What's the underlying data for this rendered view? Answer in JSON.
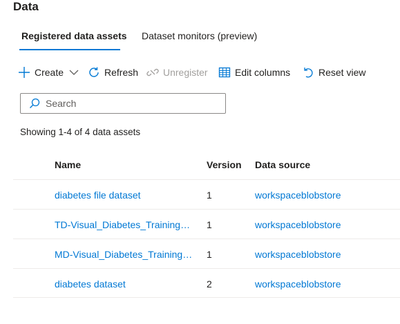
{
  "page": {
    "title": "Data"
  },
  "tabs": [
    {
      "label": "Registered data assets",
      "active": true
    },
    {
      "label": "Dataset monitors (preview)",
      "active": false
    }
  ],
  "toolbar": {
    "create": {
      "label": "Create",
      "icon": "plus-icon"
    },
    "refresh": {
      "label": "Refresh",
      "icon": "refresh-icon"
    },
    "unregister": {
      "label": "Unregister",
      "icon": "unlink-icon",
      "disabled": true
    },
    "edit_columns": {
      "label": "Edit columns",
      "icon": "table-columns-icon"
    },
    "reset_view": {
      "label": "Reset view",
      "icon": "undo-icon"
    }
  },
  "search": {
    "placeholder": "Search",
    "value": ""
  },
  "summary": {
    "text": "Showing 1-4 of 4 data assets"
  },
  "table": {
    "columns": [
      "Name",
      "Version",
      "Data source"
    ],
    "rows": [
      {
        "name": "diabetes file dataset",
        "version": "1",
        "source": "workspaceblobstore"
      },
      {
        "name": "TD-Visual_Diabetes_Training-N...",
        "version": "1",
        "source": "workspaceblobstore"
      },
      {
        "name": "MD-Visual_Diabetes_Training-Tr...",
        "version": "1",
        "source": "workspaceblobstore"
      },
      {
        "name": "diabetes dataset",
        "version": "2",
        "source": "workspaceblobstore"
      }
    ]
  },
  "colors": {
    "accent": "#0078d4",
    "text": "#201f1e",
    "disabled": "#a19f9d",
    "divider": "#edebe9"
  }
}
